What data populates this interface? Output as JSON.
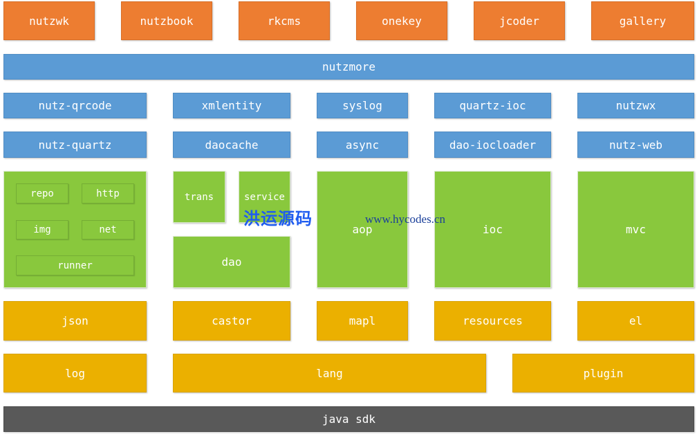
{
  "colors": {
    "apps": "#ED7D31",
    "modules": "#5B9BD5",
    "core": "#89C83D",
    "base": "#EBB000",
    "sdk": "#595959"
  },
  "apps": [
    "nutzwk",
    "nutzbook",
    "rkcms",
    "onekey",
    "jcoder",
    "gallery"
  ],
  "nutzmore": "nutzmore",
  "plugins_row1": [
    "nutz-qrcode",
    "xmlentity",
    "syslog",
    "quartz-ioc",
    "nutzwx"
  ],
  "plugins_row2": [
    "nutz-quartz",
    "daocache",
    "async",
    "dao-iocloader",
    "nutz-web"
  ],
  "tools": [
    "repo",
    "http",
    "img",
    "net",
    "runner"
  ],
  "core": {
    "trans": "trans",
    "service": "service",
    "dao": "dao",
    "aop": "aop",
    "ioc": "ioc",
    "mvc": "mvc"
  },
  "base_row1": [
    "json",
    "castor",
    "mapl",
    "resources",
    "el"
  ],
  "base_row2": [
    "log",
    "lang",
    "plugin"
  ],
  "sdk": "java sdk",
  "watermark": {
    "cn": "洪运源码",
    "url": "www.hycodes.cn"
  }
}
